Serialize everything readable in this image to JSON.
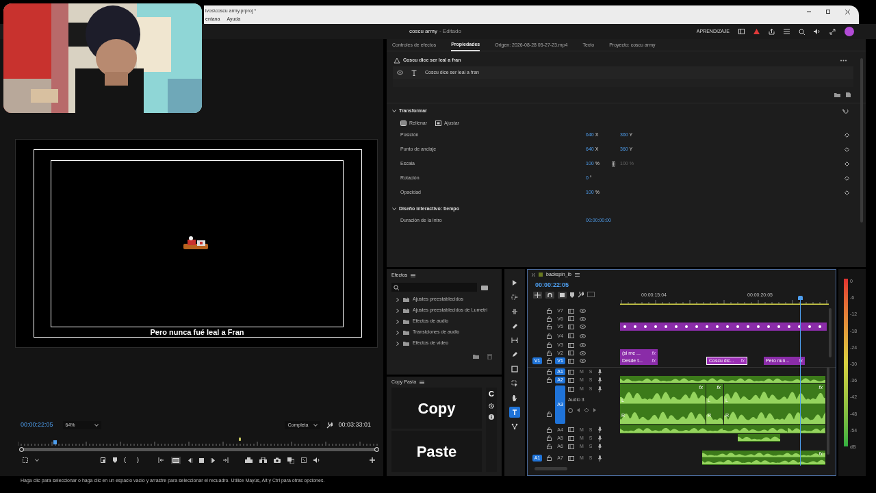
{
  "window": {
    "path": "ivos\\coscu army.prproj *",
    "menu": [
      "entana",
      "Ayuda"
    ]
  },
  "header": {
    "title": "coscu army",
    "state": "- Editado",
    "learn_label": "APRENDIZAJE"
  },
  "program_monitor": {
    "caption": "Pero nunca fué leal a Fran",
    "timecode": "00:00:22:05",
    "zoom": "64%",
    "quality": "Completa",
    "duration": "00:03:33:01",
    "playhead": {
      "level": 0.1
    }
  },
  "properties": {
    "tabs": [
      {
        "label": "Controles de efectos",
        "selected": false
      },
      {
        "label": "Propiedades",
        "selected": true
      },
      {
        "label": "Origen: 2026-08-28 05-27-23.mp4",
        "selected": false
      },
      {
        "label": "Texto",
        "selected": false
      },
      {
        "label": "Proyecto: coscu army",
        "selected": false
      }
    ],
    "layer_title": "Coscu dice ser leal a fran",
    "layer": "Coscu dice ser leal a fran",
    "sections": [
      {
        "title": "Transformar",
        "expanded": true,
        "buttons": [
          "Rellenar",
          "Ajustar"
        ],
        "rows": [
          {
            "label": "Posición",
            "kind": "value",
            "keyframe": true,
            "values": [
              {
                "value": "640",
                "unit": "X",
                "disabled": false
              },
              {
                "value": "360",
                "unit": "Y",
                "disabled": false
              }
            ]
          },
          {
            "label": "Punto de anclaje",
            "kind": "value",
            "keyframe": true,
            "values": [
              {
                "value": "640",
                "unit": "X",
                "disabled": false
              },
              {
                "value": "360",
                "unit": "Y",
                "disabled": false
              }
            ]
          },
          {
            "label": "Escala",
            "kind": "linked",
            "keyframe": true,
            "values": [
              {
                "value": "100",
                "unit": "%",
                "disabled": false
              },
              {
                "value": "100",
                "unit": "%",
                "disabled": true
              }
            ]
          },
          {
            "label": "Rotación",
            "kind": "value",
            "keyframe": true,
            "values": [
              {
                "value": "0",
                "unit": "°",
                "disabled": false
              }
            ]
          },
          {
            "label": "Opacidad",
            "kind": "value",
            "keyframe": true,
            "values": [
              {
                "value": "100",
                "unit": "%",
                "disabled": false
              }
            ]
          }
        ]
      },
      {
        "title": "Diseño interactivo: tiempo",
        "expanded": true,
        "rows": [
          {
            "label": "Duración de la intro",
            "kind": "value",
            "keyframe": false,
            "values": [
              {
                "value": "00:00:00:00",
                "disabled": false
              }
            ]
          }
        ]
      }
    ]
  },
  "effects": {
    "title": "Efectos",
    "items": [
      {
        "label": "Ajustes preestablecidos",
        "kind": "preset",
        "expanded": false
      },
      {
        "label": "Ajustes preestablecidos de Lumetri",
        "kind": "preset",
        "expanded": false
      },
      {
        "label": "Efectos de audio",
        "kind": "folder",
        "expanded": false
      },
      {
        "label": "Transiciones de audio",
        "kind": "folder",
        "expanded": false
      },
      {
        "label": "Efectos de vídeo",
        "kind": "folder",
        "expanded": false
      }
    ]
  },
  "copy_pasta": {
    "title": "Copy Pasta",
    "logo": "C",
    "buttons": [
      "Copy",
      "Paste"
    ]
  },
  "tools": [
    {
      "kind": "select",
      "selected": false
    },
    {
      "kind": "track",
      "selected": false
    },
    {
      "kind": "ripple",
      "selected": false
    },
    {
      "kind": "razor",
      "selected": false
    },
    {
      "kind": "slip",
      "selected": false
    },
    {
      "kind": "pen",
      "selected": false
    },
    {
      "kind": "rect",
      "selected": false
    },
    {
      "kind": "frame",
      "selected": false
    },
    {
      "kind": "hand",
      "selected": false
    },
    {
      "kind": "type",
      "selected": true
    },
    {
      "kind": "nodes",
      "selected": false
    }
  ],
  "timeline": {
    "sequence": "backspin_lb",
    "timecode": "00:00:22:05",
    "ruler": [
      "00:00:15:04",
      "00:00:20:05"
    ],
    "tracks": [
      {
        "name": "V7",
        "kind": "video",
        "targeted": false
      },
      {
        "name": "V6",
        "kind": "video",
        "targeted": false
      },
      {
        "name": "V5",
        "kind": "video",
        "targeted": false,
        "clips": [
          {
            "kind": "video",
            "markers": true,
            "selected": false
          }
        ]
      },
      {
        "name": "V4",
        "kind": "video",
        "targeted": false
      },
      {
        "name": "V3",
        "kind": "video",
        "targeted": false
      },
      {
        "name": "V2",
        "kind": "video",
        "targeted": false,
        "clips": [
          {
            "kind": "video",
            "label": "(si me ...",
            "badge": "fx",
            "markers": false,
            "selected": false
          }
        ]
      },
      {
        "name": "V1",
        "kind": "video",
        "targeted": true,
        "source_patch": "V1",
        "clips": [
          {
            "kind": "video",
            "label": "Desde t...",
            "badge": "fx",
            "markers": false,
            "selected": false
          },
          {
            "kind": "video",
            "label": "Coscu dic...",
            "badge": "fx",
            "markers": false,
            "selected": true
          },
          {
            "kind": "video",
            "label": "Pero nun...",
            "badge": "fx",
            "markers": false,
            "selected": false
          }
        ]
      },
      {
        "name": "A1",
        "kind": "audio",
        "targeted": true,
        "mute": "M",
        "solo": "S"
      },
      {
        "name": "A2",
        "kind": "audio",
        "targeted": true,
        "mute": "M",
        "solo": "S",
        "clips": [
          {
            "kind": "audio",
            "selected": false
          }
        ]
      },
      {
        "name": "A3",
        "kind": "audio",
        "targeted": true,
        "label": "Audio 3",
        "mute": "M",
        "solo": "S",
        "clips": [
          {
            "kind": "audio",
            "badge": "fx",
            "channels": [
              "L",
              "R"
            ],
            "selected": false
          },
          {
            "kind": "audio",
            "badge": "fx",
            "channels": [
              "L",
              "R"
            ],
            "selected": false
          },
          {
            "kind": "audio",
            "badge": "fx",
            "channels": [
              "L",
              "R"
            ],
            "selected": false
          }
        ]
      },
      {
        "name": "A4",
        "kind": "audio",
        "targeted": false,
        "mute": "M",
        "solo": "S",
        "clips": [
          {
            "kind": "audio",
            "selected": false
          },
          {
            "kind": "audio",
            "selected": false
          },
          {
            "kind": "audio",
            "selected": false
          },
          {
            "kind": "audio",
            "selected": false
          }
        ]
      },
      {
        "name": "A5",
        "kind": "audio",
        "targeted": false,
        "mute": "M",
        "solo": "S",
        "clips": [
          {
            "kind": "audio",
            "selected": false
          }
        ]
      },
      {
        "name": "A6",
        "kind": "audio",
        "targeted": false,
        "mute": "M",
        "solo": "S"
      },
      {
        "name": "A7",
        "kind": "audio",
        "targeted": false,
        "source_patch": "A1",
        "mute": "M",
        "solo": "S",
        "clips": [
          {
            "kind": "audio",
            "badge": "fx",
            "selected": false
          }
        ]
      }
    ]
  },
  "meter": {
    "scale": [
      "0",
      "-6",
      "-12",
      "-18",
      "-24",
      "-30",
      "-36",
      "-42",
      "-48",
      "-54",
      "dB"
    ]
  },
  "status_bar": "Haga clic para seleccionar o haga clic en un espacio vacío y arrastre para seleccionar el recuadro. Utilice Mayús, Alt y Ctrl para otras opciones."
}
